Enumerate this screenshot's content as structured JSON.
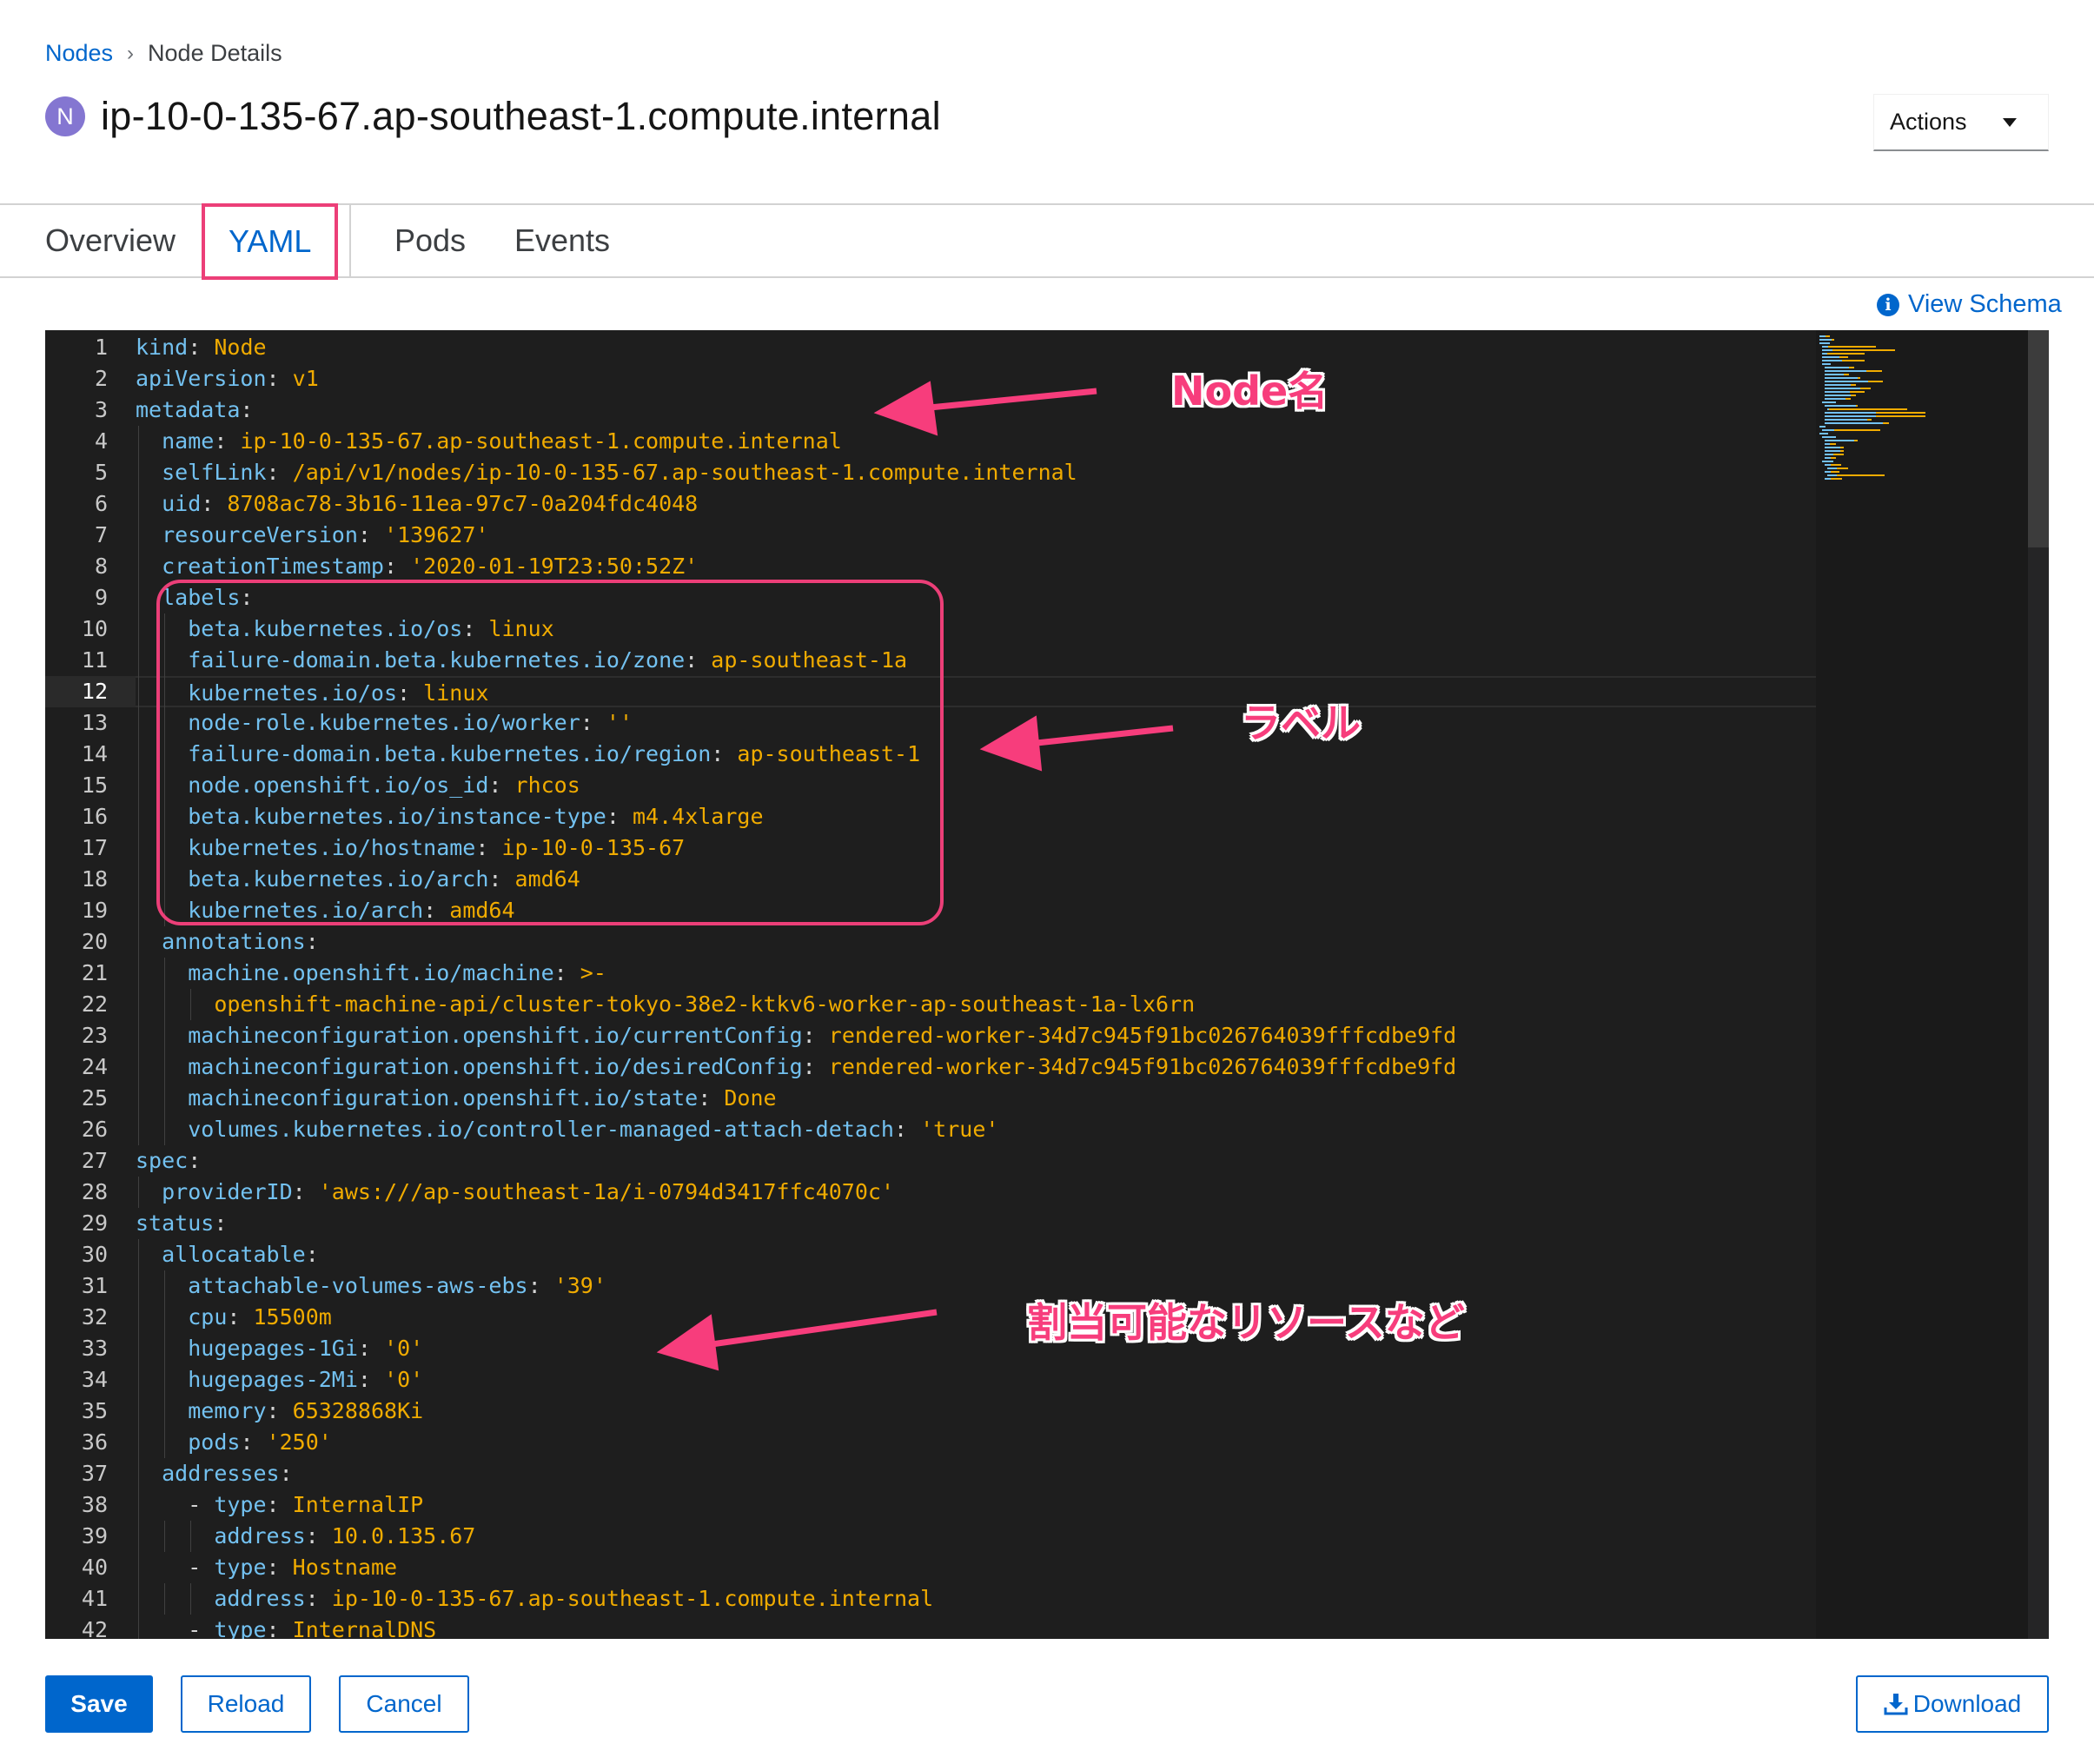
{
  "breadcrumb": {
    "parent": "Nodes",
    "separator": "›",
    "current": "Node Details"
  },
  "header": {
    "badge": "N",
    "title": "ip-10-0-135-67.ap-southeast-1.compute.internal",
    "actions_label": "Actions"
  },
  "tabs": [
    {
      "label": "Overview",
      "active": false
    },
    {
      "label": "YAML",
      "active": true
    },
    {
      "label": "Pods",
      "active": false
    },
    {
      "label": "Events",
      "active": false
    }
  ],
  "view_schema_label": "View Schema",
  "editor": {
    "current_line": 12,
    "lines": [
      {
        "n": "1",
        "i": 0,
        "k": "kind",
        "v": "Node"
      },
      {
        "n": "2",
        "i": 0,
        "k": "apiVersion",
        "v": "v1"
      },
      {
        "n": "3",
        "i": 0,
        "k": "metadata",
        "v": ""
      },
      {
        "n": "4",
        "i": 1,
        "k": "name",
        "v": "ip-10-0-135-67.ap-southeast-1.compute.internal"
      },
      {
        "n": "5",
        "i": 1,
        "k": "selfLink",
        "v": "/api/v1/nodes/ip-10-0-135-67.ap-southeast-1.compute.internal"
      },
      {
        "n": "6",
        "i": 1,
        "k": "uid",
        "v": "8708ac78-3b16-11ea-97c7-0a204fdc4048"
      },
      {
        "n": "7",
        "i": 1,
        "k": "resourceVersion",
        "v": "'139627'"
      },
      {
        "n": "8",
        "i": 1,
        "k": "creationTimestamp",
        "v": "'2020-01-19T23:50:52Z'"
      },
      {
        "n": "9",
        "i": 1,
        "k": "labels",
        "v": ""
      },
      {
        "n": "10",
        "i": 2,
        "k": "beta.kubernetes.io/os",
        "v": "linux"
      },
      {
        "n": "11",
        "i": 2,
        "k": "failure-domain.beta.kubernetes.io/zone",
        "v": "ap-southeast-1a"
      },
      {
        "n": "12",
        "i": 2,
        "k": "kubernetes.io/os",
        "v": "linux"
      },
      {
        "n": "13",
        "i": 2,
        "k": "node-role.kubernetes.io/worker",
        "v": "''"
      },
      {
        "n": "14",
        "i": 2,
        "k": "failure-domain.beta.kubernetes.io/region",
        "v": "ap-southeast-1"
      },
      {
        "n": "15",
        "i": 2,
        "k": "node.openshift.io/os_id",
        "v": "rhcos"
      },
      {
        "n": "16",
        "i": 2,
        "k": "beta.kubernetes.io/instance-type",
        "v": "m4.4xlarge"
      },
      {
        "n": "17",
        "i": 2,
        "k": "kubernetes.io/hostname",
        "v": "ip-10-0-135-67"
      },
      {
        "n": "18",
        "i": 2,
        "k": "beta.kubernetes.io/arch",
        "v": "amd64"
      },
      {
        "n": "19",
        "i": 2,
        "k": "kubernetes.io/arch",
        "v": "amd64"
      },
      {
        "n": "20",
        "i": 1,
        "k": "annotations",
        "v": ""
      },
      {
        "n": "21",
        "i": 2,
        "k": "machine.openshift.io/machine",
        "v": ">-"
      },
      {
        "n": "22",
        "i": 3,
        "k": "",
        "v": "openshift-machine-api/cluster-tokyo-38e2-ktkv6-worker-ap-southeast-1a-lx6rn"
      },
      {
        "n": "23",
        "i": 2,
        "k": "machineconfiguration.openshift.io/currentConfig",
        "v": "rendered-worker-34d7c945f91bc026764039fffcdbe9fd"
      },
      {
        "n": "24",
        "i": 2,
        "k": "machineconfiguration.openshift.io/desiredConfig",
        "v": "rendered-worker-34d7c945f91bc026764039fffcdbe9fd"
      },
      {
        "n": "25",
        "i": 2,
        "k": "machineconfiguration.openshift.io/state",
        "v": "Done"
      },
      {
        "n": "26",
        "i": 2,
        "k": "volumes.kubernetes.io/controller-managed-attach-detach",
        "v": "'true'"
      },
      {
        "n": "27",
        "i": 0,
        "k": "spec",
        "v": ""
      },
      {
        "n": "28",
        "i": 1,
        "k": "providerID",
        "v": "'aws:///ap-southeast-1a/i-0794d3417ffc4070c'"
      },
      {
        "n": "29",
        "i": 0,
        "k": "status",
        "v": ""
      },
      {
        "n": "30",
        "i": 1,
        "k": "allocatable",
        "v": ""
      },
      {
        "n": "31",
        "i": 2,
        "k": "attachable-volumes-aws-ebs",
        "v": "'39'"
      },
      {
        "n": "32",
        "i": 2,
        "k": "cpu",
        "v": "15500m"
      },
      {
        "n": "33",
        "i": 2,
        "k": "hugepages-1Gi",
        "v": "'0'"
      },
      {
        "n": "34",
        "i": 2,
        "k": "hugepages-2Mi",
        "v": "'0'"
      },
      {
        "n": "35",
        "i": 2,
        "k": "memory",
        "v": "65328868Ki"
      },
      {
        "n": "36",
        "i": 2,
        "k": "pods",
        "v": "'250'"
      },
      {
        "n": "37",
        "i": 1,
        "k": "addresses",
        "v": ""
      },
      {
        "n": "38",
        "i": 2,
        "d": true,
        "k": "type",
        "v": "InternalIP"
      },
      {
        "n": "39",
        "i": 3,
        "k": "address",
        "v": "10.0.135.67"
      },
      {
        "n": "40",
        "i": 2,
        "d": true,
        "k": "type",
        "v": "Hostname"
      },
      {
        "n": "41",
        "i": 3,
        "k": "address",
        "v": "ip-10-0-135-67.ap-southeast-1.compute.internal"
      },
      {
        "n": "42",
        "i": 2,
        "d": true,
        "k": "type",
        "v": "InternalDNS"
      }
    ]
  },
  "annotations": {
    "node_name": "Node名",
    "labels": "ラベル",
    "allocatable": "割当可能なリソースなど"
  },
  "buttons": {
    "save": "Save",
    "reload": "Reload",
    "cancel": "Cancel",
    "download": "Download"
  },
  "colors": {
    "key": "#73c1f0",
    "value": "#f0ab00",
    "editor_bg": "#1e1e1e",
    "annotation": "#ec3f78",
    "primary": "#0066cc"
  }
}
